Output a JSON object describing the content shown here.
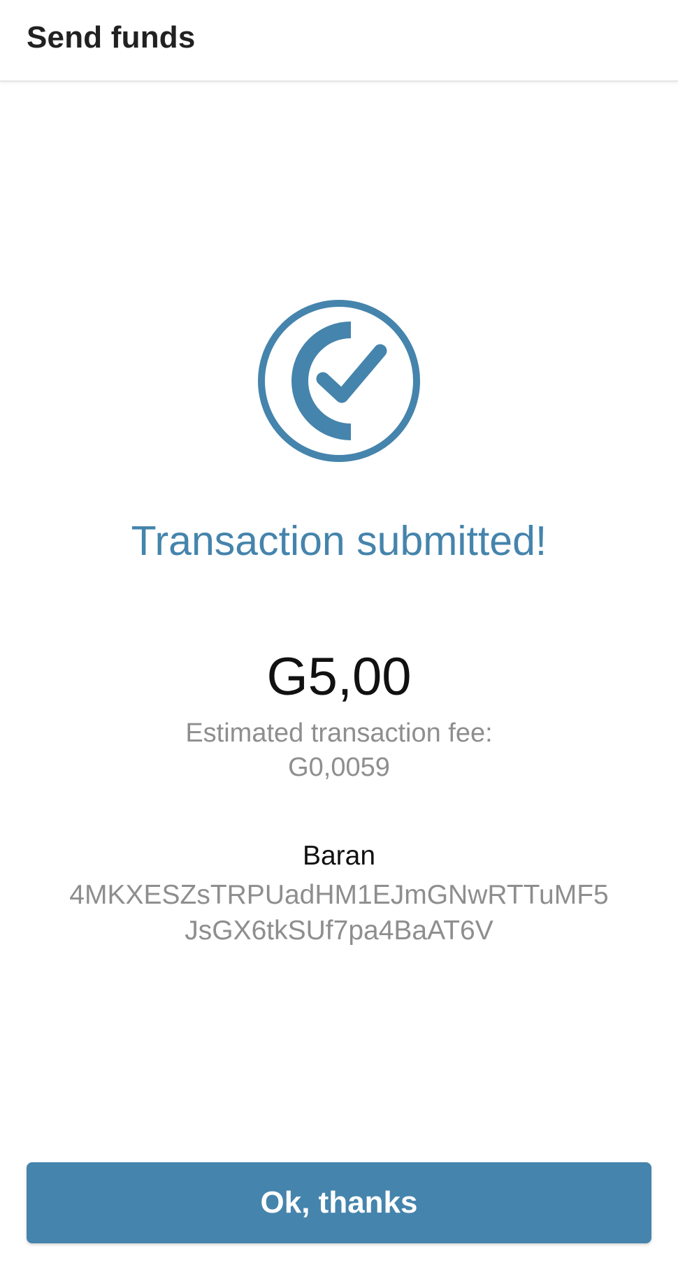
{
  "app_bar": {
    "title": "Send funds"
  },
  "status": {
    "icon": "check-circle-icon",
    "headline": "Transaction submitted!",
    "accent_color": "#4584ac"
  },
  "transaction": {
    "amount": "G5,00",
    "fee_label": "Estimated transaction fee:",
    "fee_value": "G0,0059"
  },
  "recipient": {
    "name": "Baran",
    "address_line_1": "4MKXESZsTRPUadHM1EJmGNwRTTuMF5",
    "address_line_2": "JsGX6tkSUf7pa4BaAT6V"
  },
  "actions": {
    "ok_label": "Ok, thanks"
  }
}
